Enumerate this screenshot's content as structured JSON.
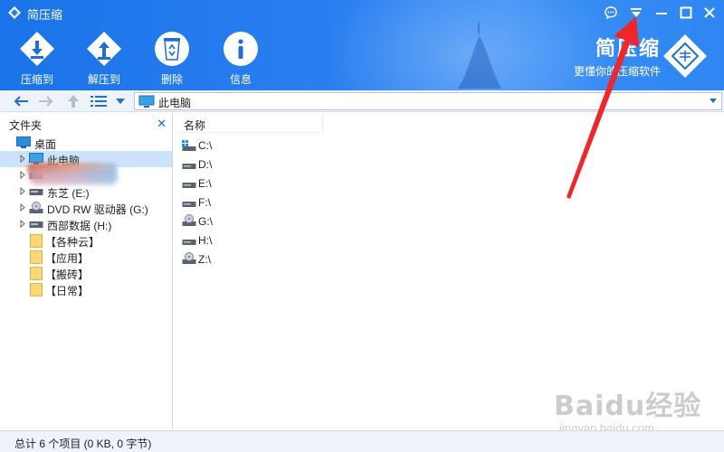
{
  "window": {
    "title": "简压缩",
    "controls": [
      "feedback-icon",
      "menu-dropdown-icon",
      "minimize-icon",
      "maximize-icon",
      "close-icon"
    ]
  },
  "toolbar": {
    "compress_label": "压缩到",
    "extract_label": "解压到",
    "delete_label": "删除",
    "info_label": "信息"
  },
  "brand": {
    "name": "简压缩",
    "slogan": "更懂你的压缩软件"
  },
  "addressbar": {
    "path": "此电脑"
  },
  "folders": {
    "title": "文件夹",
    "tree": [
      {
        "label": "桌面",
        "icon": "desktop-icon"
      },
      {
        "label": "此电脑",
        "icon": "computer-icon"
      },
      {
        "label": "",
        "icon": "drive-icon"
      },
      {
        "label": "东芝 (E:)",
        "icon": "drive-icon"
      },
      {
        "label": "DVD RW 驱动器 (G:)",
        "icon": "disc-drive-icon"
      },
      {
        "label": "西部数据 (H:)",
        "icon": "drive-icon"
      },
      {
        "label": "【各种云】",
        "icon": "folder-icon"
      },
      {
        "label": "【应用】",
        "icon": "folder-icon"
      },
      {
        "label": "【搬砖】",
        "icon": "folder-icon"
      },
      {
        "label": "【日常】",
        "icon": "folder-icon"
      }
    ]
  },
  "files": {
    "column_name": "名称",
    "rows": [
      {
        "label": "C:\\",
        "icon": "system-drive-icon"
      },
      {
        "label": "D:\\",
        "icon": "drive-icon"
      },
      {
        "label": "E:\\",
        "icon": "drive-icon"
      },
      {
        "label": "F:\\",
        "icon": "drive-icon"
      },
      {
        "label": "G:\\",
        "icon": "disc-drive-icon"
      },
      {
        "label": "H:\\",
        "icon": "drive-icon"
      },
      {
        "label": "Z:\\",
        "icon": "disc-drive-icon"
      }
    ]
  },
  "status": {
    "text": "总计 6 个项目 (0 KB, 0 字节)"
  },
  "watermark": {
    "main": "Baidu经验",
    "sub": "jingyan.baidu.com"
  },
  "colors": {
    "header": "#1a73e8",
    "accent": "#1f6fd6",
    "selection": "#cce2f8",
    "annotation": "#f0262a"
  }
}
